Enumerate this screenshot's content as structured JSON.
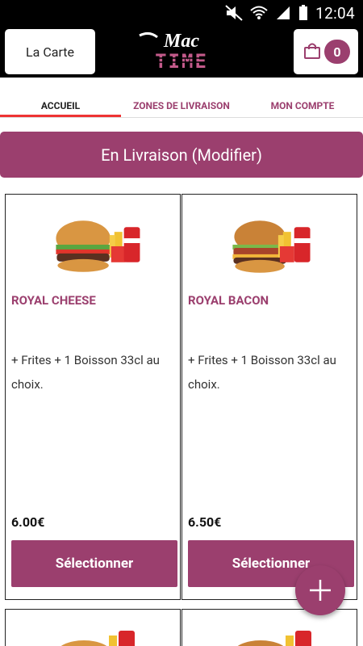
{
  "status_bar": {
    "time": "12:04"
  },
  "app_bar": {
    "menu_button_label": "La Carte",
    "logo_top": "Mac",
    "logo_bottom": "TIME",
    "cart_count": "0"
  },
  "tabs": [
    {
      "label": "ACCUEIL",
      "active": true
    },
    {
      "label": "ZONES DE LIVRAISON",
      "active": false
    },
    {
      "label": "MON COMPTE",
      "active": false
    }
  ],
  "delivery_banner": "En Livraison (Modifier)",
  "products": [
    {
      "name": "ROYAL CHEESE",
      "description": "+ Frites + 1 Boisson 33cl au choix.",
      "price": "6.00€",
      "button": "Sélectionner"
    },
    {
      "name": "ROYAL BACON",
      "description": "+ Frites + 1 Boisson 33cl au choix.",
      "price": "6.50€",
      "button": "Sélectionner"
    }
  ],
  "colors": {
    "brand": "#9b3f6e",
    "accent": "#ee3333",
    "bar": "#000000"
  },
  "icons": [
    "signal-icon",
    "wifi-icon",
    "mute-icon",
    "battery-icon",
    "shopping-bag-icon",
    "plus-icon"
  ]
}
